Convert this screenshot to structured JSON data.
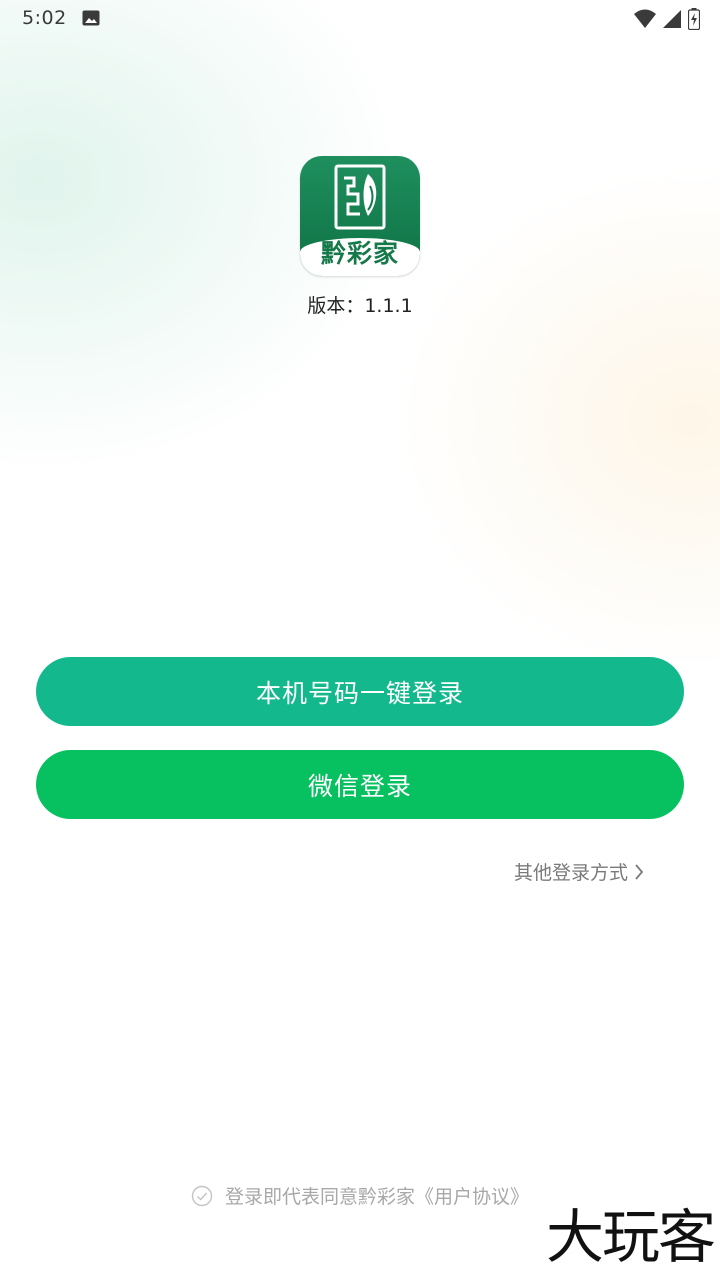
{
  "status_bar": {
    "time": "5:02",
    "icons": [
      "image-icon",
      "wifi-icon",
      "signal-icon",
      "battery-charging-icon"
    ]
  },
  "app": {
    "logo_text": "黔彩家",
    "version": "版本：1.1.1"
  },
  "buttons": {
    "phone_login": "本机号码一键登录",
    "wechat_login": "微信登录"
  },
  "other_login": {
    "label": "其他登录方式",
    "icon": "chevron-right-icon"
  },
  "agreement": {
    "text": "登录即代表同意黔彩家《用户协议》",
    "icon": "check-circle-icon"
  },
  "watermark": "大玩客",
  "colors": {
    "phone_button": "#13b98c",
    "wechat_button": "#07c160",
    "logo_green": "#16794a"
  }
}
